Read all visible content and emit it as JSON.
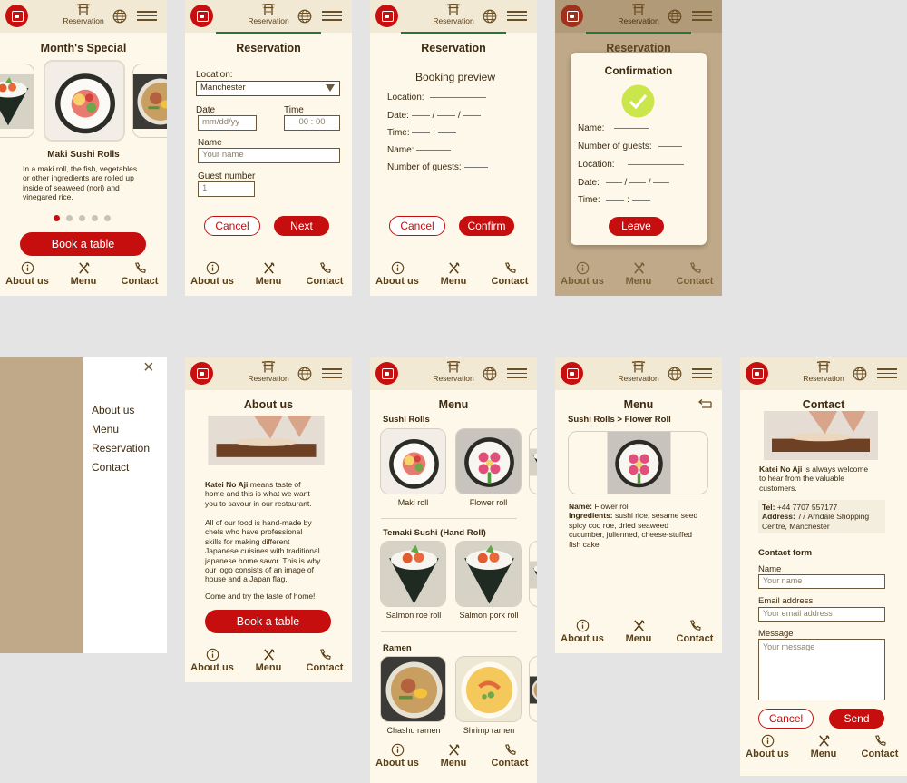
{
  "header": {
    "reservation": "Reservation"
  },
  "nav": {
    "about": "About us",
    "menu": "Menu",
    "contact": "Contact"
  },
  "s1": {
    "title": "Month's Special",
    "dish": "Maki Sushi Rolls",
    "desc1": "In a maki roll, the fish, vegetables",
    "desc2": "or other ingredients are rolled up",
    "desc3": "inside of seaweed (nori) and",
    "desc4": "vinegared rice.",
    "book": "Book a table"
  },
  "s2": {
    "title": "Reservation",
    "location_label": "Location:",
    "location_value": "Manchester",
    "date_label": "Date",
    "date_ph": "mm/dd/yy",
    "time_label": "Time",
    "time_value": "00 : 00",
    "name_label": "Name",
    "name_ph": "Your name",
    "guest_label": "Guest number",
    "guest_value": "1",
    "cancel": "Cancel",
    "next": "Next"
  },
  "s3": {
    "title": "Reservation",
    "heading": "Booking preview",
    "location": "Location:",
    "date": "Date:",
    "time": "Time:",
    "name": "Name:",
    "guests": "Number of guests:",
    "cancel": "Cancel",
    "confirm": "Confirm",
    "slash": "/",
    "colon": ":"
  },
  "s4": {
    "title": "Reservation",
    "modal_title": "Confirmation",
    "name": "Name:",
    "guests": "Number of guests:",
    "location": "Location:",
    "date": "Date:",
    "time": "Time:",
    "leave": "Leave"
  },
  "s5": {
    "items": [
      "About us",
      "Menu",
      "Reservation",
      "Contact"
    ],
    "close": "×"
  },
  "s6": {
    "title": "About us",
    "p1a": "Katei No Aji",
    "p1b": " means taste of",
    "p1c": "home and this is what we want",
    "p1d": "you to savour in our restaurant.",
    "p2a": "All of our food is hand-made by",
    "p2b": "chefs who have professional",
    "p2c": "skills for making different",
    "p2d": "Japanese cuisines with traditional",
    "p2e": "japanese home savor. This is why",
    "p2f": "our logo consists of an image of",
    "p2g": "house and a Japan flag.",
    "p3": "Come and try the taste of home!",
    "book": "Book a table"
  },
  "s7": {
    "title": "Menu",
    "sec1": "Sushi Rolls",
    "c1": "Maki roll",
    "c2": "Flower roll",
    "sec2": "Temaki Sushi (Hand Roll)",
    "c3": "Salmon roe roll",
    "c4": "Salmon pork roll",
    "sec3": "Ramen",
    "c5": "Chashu ramen",
    "c6": "Shrimp ramen"
  },
  "s8": {
    "title": "Menu",
    "crumb": "Sushi Rolls > Flower Roll",
    "name_b": "Name:",
    "name_v": " Flower roll",
    "ing_b": "Ingredients:",
    "ing1": " sushi rice, sesame seed",
    "ing2": "spicy cod roe, dried seaweed",
    "ing3": "cucumber, julienned, cheese-stuffed",
    "ing4": "fish cake"
  },
  "s9": {
    "title": "Contact",
    "w1a": "Katei No Aji",
    "w1b": " is always welcome",
    "w2": "to hear from the valuable",
    "w3": "customers.",
    "tel_b": "Tel:",
    "tel_v": " +44 7707 557177",
    "addr_b": "Address:",
    "addr_v": " 77 Arndale Shopping",
    "addr2": "Centre, Manchester",
    "form": "Contact form",
    "name_label": "Name",
    "name_ph": "Your name",
    "email_label": "Email address",
    "email_ph": "Your email address",
    "msg_label": "Message",
    "msg_ph": "Your message",
    "cancel": "Cancel",
    "send": "Send"
  },
  "colors": {
    "accent": "#c70e0e",
    "green": "#1c7a3e",
    "cream": "#fdf8ea",
    "tan": "#bfa988"
  }
}
